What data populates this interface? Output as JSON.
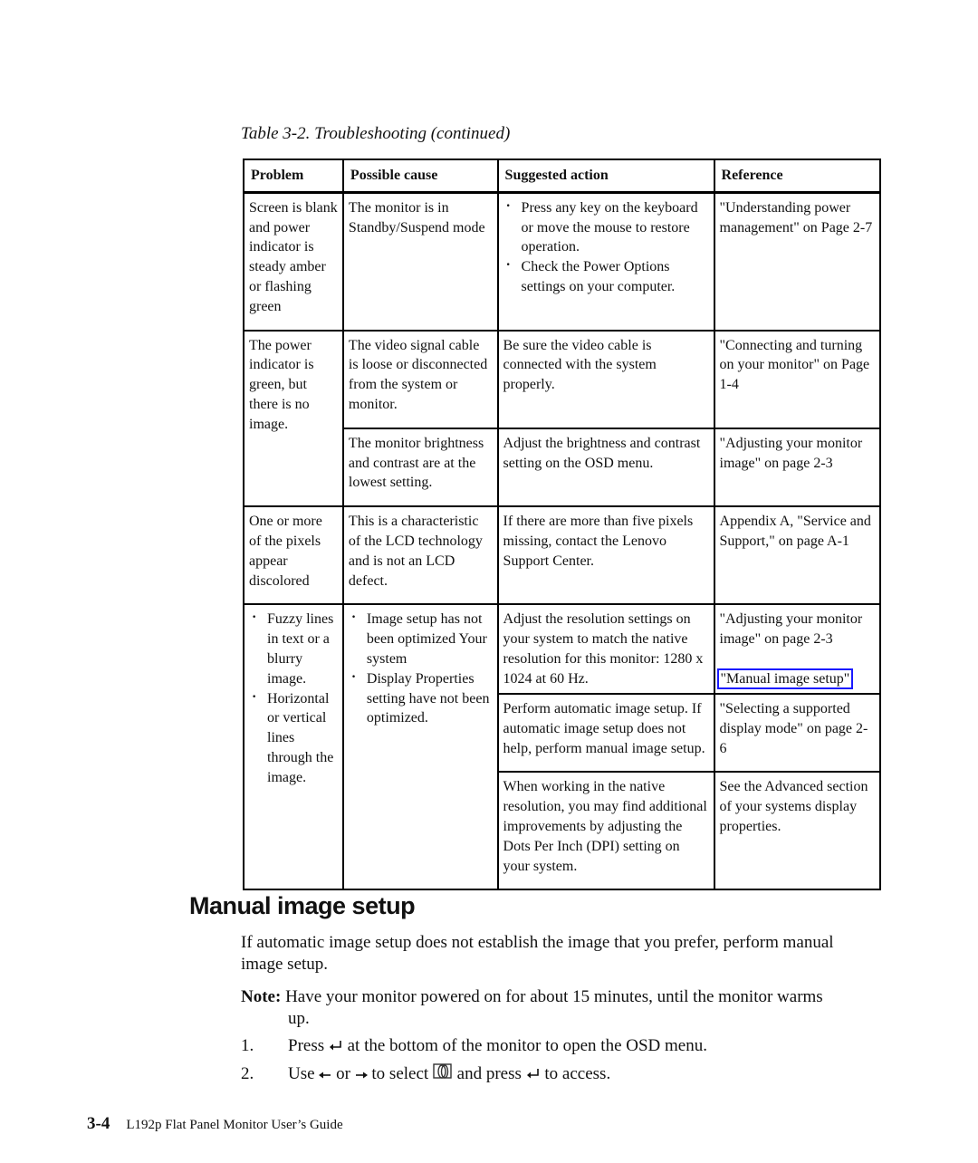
{
  "caption": "Table 3-2. Troubleshooting (continued)",
  "table": {
    "headers": [
      "Problem",
      "Possible cause",
      "Suggested action",
      "Reference"
    ],
    "rows": [
      {
        "problem": "Screen is blank and power indicator is steady amber or flashing green",
        "cause": "The monitor is in Standby/Suspend mode",
        "action_bullets": [
          "Press any key on the keyboard or move the mouse to restore operation.",
          "Check the Power Options settings on your computer."
        ],
        "reference": "\"Understanding power management\" on  Page 2-7"
      },
      {
        "problem": "The power indicator is green, but there is no image.",
        "sub": [
          {
            "cause": "The video signal cable is loose or disconnected from the system or monitor.",
            "action": "Be sure the video cable is connected with the system properly.",
            "reference": "\"Connecting and turning on your monitor\" on Page 1-4"
          },
          {
            "cause": "The monitor brightness and contrast are at the lowest setting.",
            "action": "Adjust the brightness and contrast setting on the OSD menu.",
            "reference": "\"Adjusting your monitor image\" on page 2-3"
          }
        ]
      },
      {
        "problem": "One or more of the pixels appear discolored",
        "cause": "This is a characteristic of the LCD technology and is not an LCD defect.",
        "action": "If there are more than five pixels missing, contact the Lenovo Support Center.",
        "reference": "Appendix A, \"Service and Support,\" on page A-1"
      },
      {
        "problem_bullets": [
          "Fuzzy lines in text or a blurry image.",
          "Horizontal or vertical lines through the image."
        ],
        "cause_bullets": [
          "Image setup has not been optimized Your system",
          "Display Properties setting have not been optimized."
        ],
        "sub": [
          {
            "action": "Adjust the resolution settings on your system to match the native resolution for this monitor: 1280 x 1024 at 60 Hz.",
            "reference": "\"Adjusting your monitor image\" on page 2-3",
            "reference_link": "\"Manual image setup\""
          },
          {
            "action": "Perform automatic image setup. If automatic image setup does not help, perform manual image setup.",
            "reference": "\"Selecting a supported display mode\" on page 2-6"
          },
          {
            "action": "When working in the native resolution, you may find additional improvements by adjusting the Dots Per Inch (DPI) setting on your system.",
            "reference": "See the Advanced section of your systems display properties."
          }
        ]
      }
    ]
  },
  "section": {
    "title": "Manual image setup",
    "intro": "If automatic image setup does not establish the image that you prefer, perform manual image setup.",
    "note_label": "Note:",
    "note_line1": " Have your monitor powered on for about 15 minutes, until the monitor warms",
    "note_line2": "up.",
    "steps": [
      {
        "num": "1.",
        "a": "Press ",
        "icon1": "enter-icon",
        "b": " at the bottom of the monitor to open the OSD menu."
      },
      {
        "num": "2.",
        "a": "Use ",
        "icon1": "left-arrow-icon",
        "b": " or ",
        "icon2": "right-arrow-icon",
        "c": " to select ",
        "icon3": "image-setup-icon",
        "d": " and press ",
        "icon4": "enter-icon",
        "e": " to access."
      }
    ]
  },
  "footer": {
    "page_number": "3-4",
    "title": "L192p Flat Panel Monitor User’s Guide"
  },
  "colors": {
    "link_border": "#1a1aff"
  }
}
